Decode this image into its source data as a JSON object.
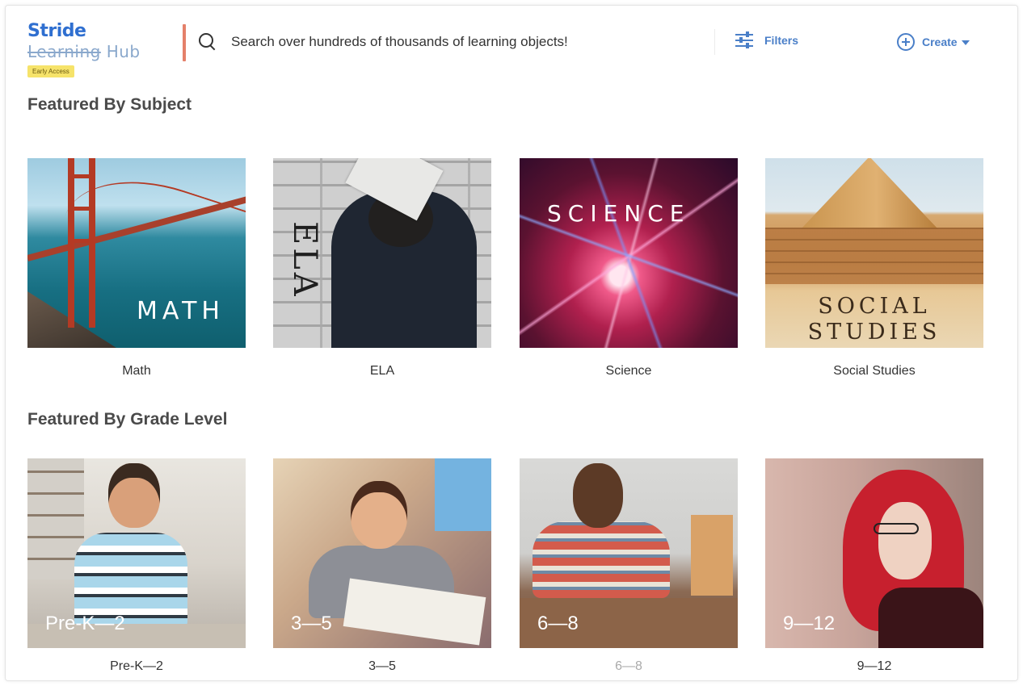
{
  "header": {
    "logo_primary": "Stride",
    "logo_strike": "Learning",
    "logo_secondary": "Hub",
    "badge": "Early Access",
    "search_placeholder": "Search over hundreds of thousands of learning objects!",
    "filters_label": "Filters",
    "create_label": "Create"
  },
  "colors": {
    "brand_blue": "#2f6fd0",
    "accent_blue": "#4a7fc8",
    "accent_divider": "#e4806a",
    "badge_yellow": "#f6e36a"
  },
  "subjects": {
    "title": "Featured By Subject",
    "items": [
      {
        "tile_text": "MATH",
        "caption": "Math"
      },
      {
        "tile_text": "ELA",
        "caption": "ELA"
      },
      {
        "tile_text": "SCIENCE",
        "caption": "Science"
      },
      {
        "tile_text_line1": "SOCIAL",
        "tile_text_line2": "STUDIES",
        "caption": "Social Studies"
      }
    ]
  },
  "grades": {
    "title": "Featured By Grade Level",
    "items": [
      {
        "tile_text": "Pre-K—2",
        "caption": "Pre-K—2"
      },
      {
        "tile_text": "3—5",
        "caption": "3—5"
      },
      {
        "tile_text": "6—8",
        "caption": "6—8"
      },
      {
        "tile_text": "9—12",
        "caption": "9—12"
      }
    ]
  },
  "icons": [
    "search-icon",
    "filters-icon",
    "plus-circle-icon",
    "caret-down-icon"
  ]
}
